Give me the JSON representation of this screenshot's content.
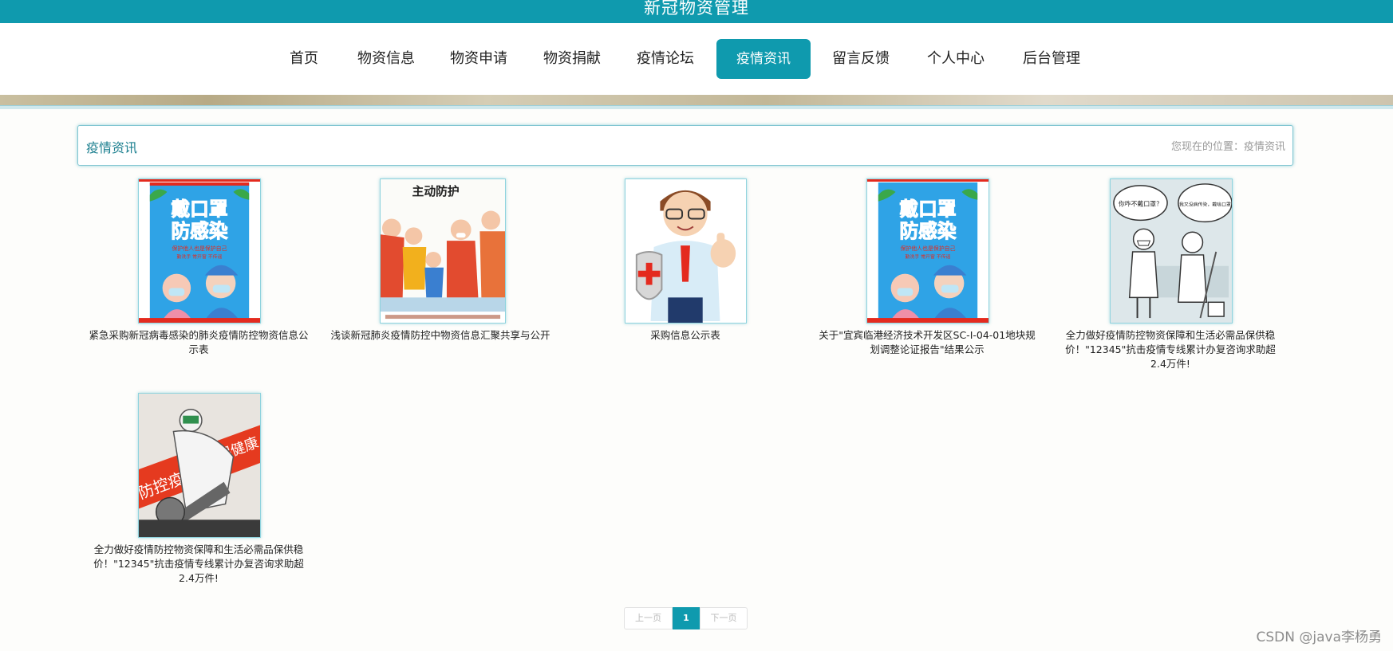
{
  "header": {
    "title": "新冠物资管理"
  },
  "nav": {
    "items": [
      {
        "label": "首页"
      },
      {
        "label": "物资信息"
      },
      {
        "label": "物资申请"
      },
      {
        "label": "物资捐献"
      },
      {
        "label": "疫情论坛"
      },
      {
        "label": "疫情资讯",
        "active": true
      },
      {
        "label": "留言反馈"
      },
      {
        "label": "个人中心"
      },
      {
        "label": "后台管理"
      }
    ]
  },
  "section": {
    "title": "疫情资讯",
    "breadcrumb": "您现在的位置：疫情资讯"
  },
  "news": [
    {
      "title": "紧急采购新冠病毒感染的肺炎疫情防控物资信息公示表",
      "image": {
        "headline": "戴口罩",
        "headline2": "防感染",
        "subtitle": "保护他人也是保护自己",
        "subtitle2": "勤洗手 常开窗 不传谣"
      }
    },
    {
      "title": "浅谈新冠肺炎疫情防控中物资信息汇聚共享与公开",
      "image": {
        "headline": "主动防护"
      }
    },
    {
      "title": "采购信息公示表",
      "image": {}
    },
    {
      "title": "关于\"宜宾临港经济技术开发区SC-I-04-01地块规划调整论证报告\"结果公示",
      "image": {
        "headline": "戴口罩",
        "headline2": "防感染",
        "subtitle": "保护他人也是保护自己",
        "subtitle2": "勤洗手 常开窗 不传谣"
      }
    },
    {
      "title": "全力做好疫情防控物资保障和生活必需品保供稳价！\"12345\"抗击疫情专线累计办复咨询求助超2.4万件!",
      "image": {
        "bubble1": "你咋不戴口罩？",
        "bubble2": "我又没病传染，戴啥口罩"
      }
    },
    {
      "title": "全力做好疫情防控物资保障和生活必需品保供稳价！\"12345\"抗击疫情专线累计办复咨询求助超2.4万件!",
      "image": {
        "banner": "防控疫情",
        "banner2": "保健康"
      }
    }
  ],
  "pagination": {
    "prev": "上一页",
    "current": "1",
    "next": "下一页"
  },
  "watermark": "CSDN @java李杨勇",
  "colors": {
    "primary": "#0f9aae",
    "poster_red": "#e42a1e",
    "sky_blue": "#2fa3e6"
  }
}
